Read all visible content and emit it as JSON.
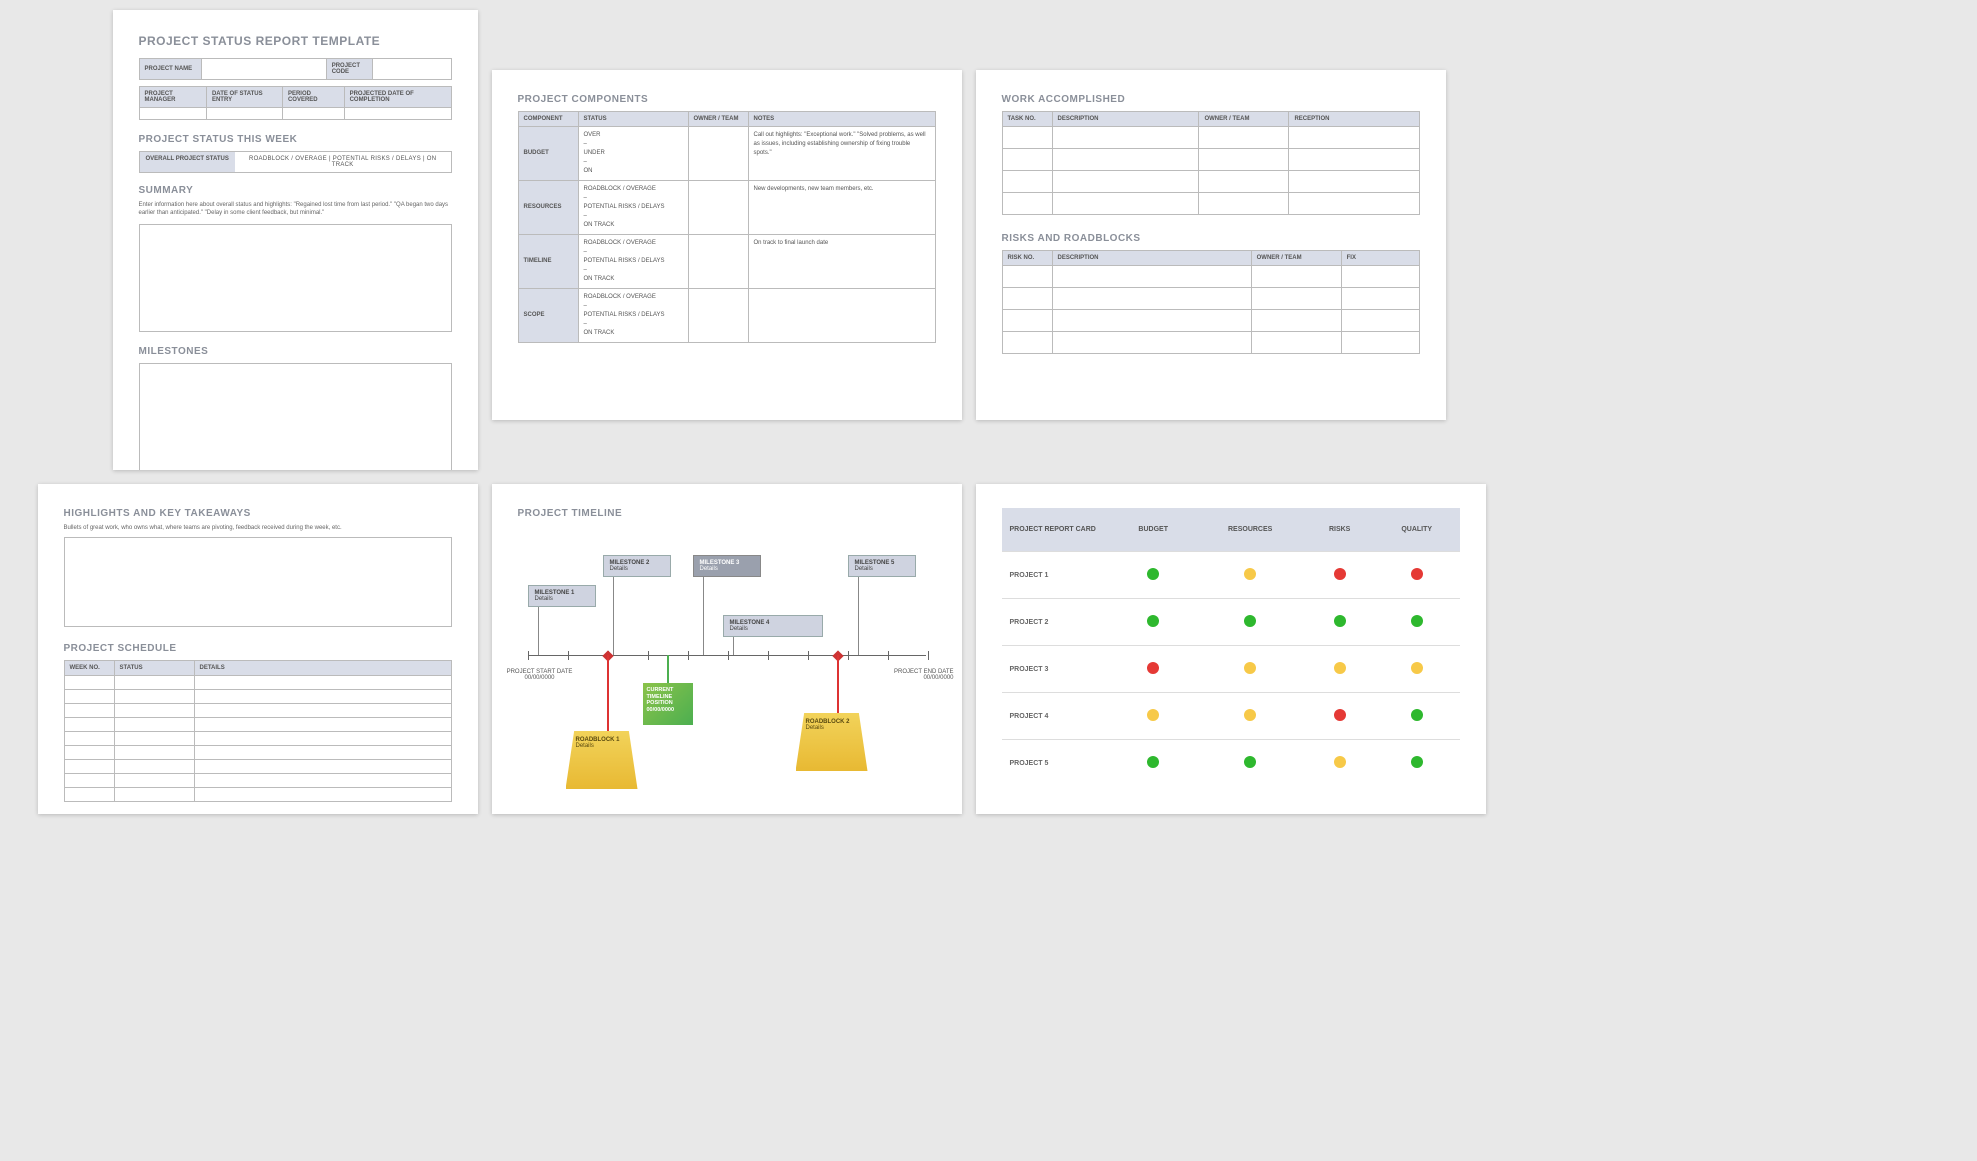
{
  "page1": {
    "title": "PROJECT STATUS REPORT TEMPLATE",
    "row1": {
      "c1": "PROJECT NAME",
      "c2": "PROJECT CODE"
    },
    "row2": {
      "c1": "PROJECT MANAGER",
      "c2": "DATE OF STATUS ENTRY",
      "c3": "PERIOD COVERED",
      "c4": "PROJECTED DATE OF COMPLETION"
    },
    "status_week_title": "PROJECT STATUS THIS WEEK",
    "status_label": "OVERALL PROJECT STATUS",
    "status_items": "ROADBLOCK / OVERAGE   |   POTENTIAL RISKS / DELAYS   |   ON TRACK",
    "summary_title": "SUMMARY",
    "summary_note": "Enter information here about overall status and highlights: \"Regained lost time from last period.\" \"QA began two days earlier than anticipated.\" \"Delay in some client feedback, but minimal.\"",
    "milestones_title": "MILESTONES"
  },
  "page2": {
    "title": "PROJECT COMPONENTS",
    "headers": [
      "COMPONENT",
      "STATUS",
      "OWNER / TEAM",
      "NOTES"
    ],
    "rows": [
      {
        "name": "BUDGET",
        "status": "OVER\n–\nUNDER\n–\nON",
        "notes": "Call out highlights: \"Exceptional work.\" \"Solved problems, as well as issues, including establishing ownership of fixing trouble spots.\""
      },
      {
        "name": "RESOURCES",
        "status": "ROADBLOCK / OVERAGE\n–\nPOTENTIAL RISKS / DELAYS\n–\nON TRACK",
        "notes": "New developments, new team members, etc."
      },
      {
        "name": "TIMELINE",
        "status": "ROADBLOCK / OVERAGE\n–\nPOTENTIAL RISKS / DELAYS\n–\nON TRACK",
        "notes": "On track to final launch date"
      },
      {
        "name": "SCOPE",
        "status": "ROADBLOCK / OVERAGE\n–\nPOTENTIAL RISKS / DELAYS\n–\nON TRACK",
        "notes": ""
      }
    ]
  },
  "page3": {
    "wa_title": "WORK ACCOMPLISHED",
    "wa_headers": [
      "TASK NO.",
      "DESCRIPTION",
      "OWNER / TEAM",
      "RECEPTION"
    ],
    "rr_title": "RISKS AND ROADBLOCKS",
    "rr_headers": [
      "RISK NO.",
      "DESCRIPTION",
      "OWNER / TEAM",
      "FIX"
    ]
  },
  "page4": {
    "title": "HIGHLIGHTS AND KEY TAKEAWAYS",
    "note": "Bullets of great work, who owns what, where teams are pivoting, feedback received during the week, etc.",
    "sched_title": "PROJECT SCHEDULE",
    "sched_headers": [
      "WEEK NO.",
      "STATUS",
      "DETAILS"
    ]
  },
  "page5": {
    "title": "PROJECT TIMELINE",
    "start": {
      "l1": "PROJECT START DATE",
      "l2": "00/00/0000"
    },
    "end": {
      "l1": "PROJECT END DATE",
      "l2": "00/00/0000"
    },
    "m1": {
      "t": "MILESTONE 1",
      "d": "Details"
    },
    "m2": {
      "t": "MILESTONE 2",
      "d": "Details"
    },
    "m3": {
      "t": "MILESTONE 3",
      "d": "Details"
    },
    "m4": {
      "t": "MILESTONE 4",
      "d": "Details"
    },
    "m5": {
      "t": "MILESTONE 5",
      "d": "Details"
    },
    "current": {
      "l1": "CURRENT",
      "l2": "TIMELINE",
      "l3": "POSITION",
      "l4": "00/00/0000"
    },
    "r1": {
      "t": "ROADBLOCK 1",
      "d": "Details"
    },
    "r2": {
      "t": "ROADBLOCK 2",
      "d": "Details"
    }
  },
  "page6": {
    "headers": [
      "PROJECT REPORT CARD",
      "BUDGET",
      "RESOURCES",
      "RISKS",
      "QUALITY"
    ],
    "rows": [
      {
        "name": "PROJECT 1",
        "cells": [
          "g",
          "y",
          "r",
          "r"
        ]
      },
      {
        "name": "PROJECT 2",
        "cells": [
          "g",
          "g",
          "g",
          "g"
        ]
      },
      {
        "name": "PROJECT 3",
        "cells": [
          "r",
          "y",
          "y",
          "y"
        ]
      },
      {
        "name": "PROJECT 4",
        "cells": [
          "y",
          "y",
          "r",
          "g"
        ]
      },
      {
        "name": "PROJECT 5",
        "cells": [
          "g",
          "g",
          "y",
          "g"
        ]
      }
    ]
  }
}
